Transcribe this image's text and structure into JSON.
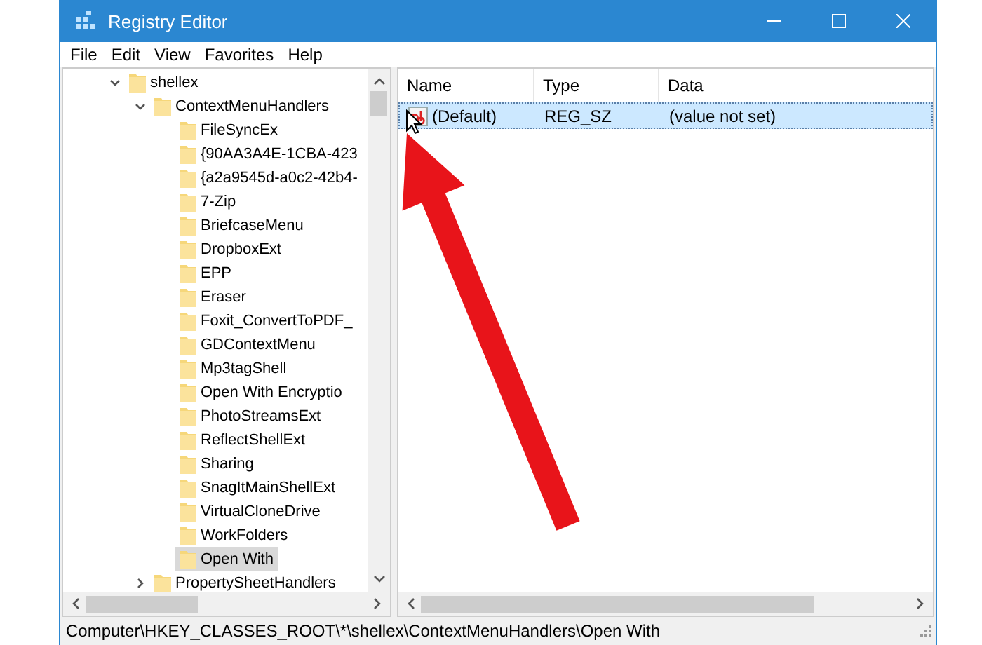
{
  "window": {
    "title": "Registry Editor"
  },
  "menu": [
    {
      "label": "File",
      "selected": false
    },
    {
      "label": "Edit",
      "selected": false
    },
    {
      "label": "View",
      "selected": false
    },
    {
      "label": "Favorites",
      "selected": false
    },
    {
      "label": "Help",
      "selected": false
    }
  ],
  "tree": [
    {
      "label": "shellex",
      "expanded": true,
      "selected": false,
      "children": [
        {
          "label": "ContextMenuHandlers",
          "expanded": true,
          "selected": false,
          "children": [
            {
              "label": "FileSyncEx",
              "selected": false
            },
            {
              "label": "{90AA3A4E-1CBA-423",
              "selected": false
            },
            {
              "label": "{a2a9545d-a0c2-42b4-",
              "selected": false
            },
            {
              "label": "7-Zip",
              "selected": false
            },
            {
              "label": "BriefcaseMenu",
              "selected": false
            },
            {
              "label": "DropboxExt",
              "selected": false
            },
            {
              "label": "EPP",
              "selected": false
            },
            {
              "label": "Eraser",
              "selected": false
            },
            {
              "label": "Foxit_ConvertToPDF_",
              "selected": false
            },
            {
              "label": "GDContextMenu",
              "selected": false
            },
            {
              "label": "Mp3tagShell",
              "selected": false
            },
            {
              "label": "Open With Encryptio",
              "selected": false
            },
            {
              "label": "PhotoStreamsExt",
              "selected": false
            },
            {
              "label": "ReflectShellExt",
              "selected": false
            },
            {
              "label": "Sharing",
              "selected": false
            },
            {
              "label": "SnagItMainShellExt",
              "selected": false
            },
            {
              "label": "VirtualCloneDrive",
              "selected": false
            },
            {
              "label": "WorkFolders",
              "selected": false
            },
            {
              "label": "Open With",
              "selected": true
            }
          ]
        },
        {
          "label": "PropertySheetHandlers",
          "expanded": false,
          "selected": false
        }
      ]
    }
  ],
  "values": {
    "columns": [
      "Name",
      "Type",
      "Data"
    ],
    "rows": [
      {
        "name": "(Default)",
        "type": "REG_SZ",
        "data": "(value not set)",
        "selected": true
      }
    ]
  },
  "status_bar": {
    "text": "Computer\\HKEY_CLASSES_ROOT\\*\\shellex\\ContextMenuHandlers\\Open With"
  }
}
